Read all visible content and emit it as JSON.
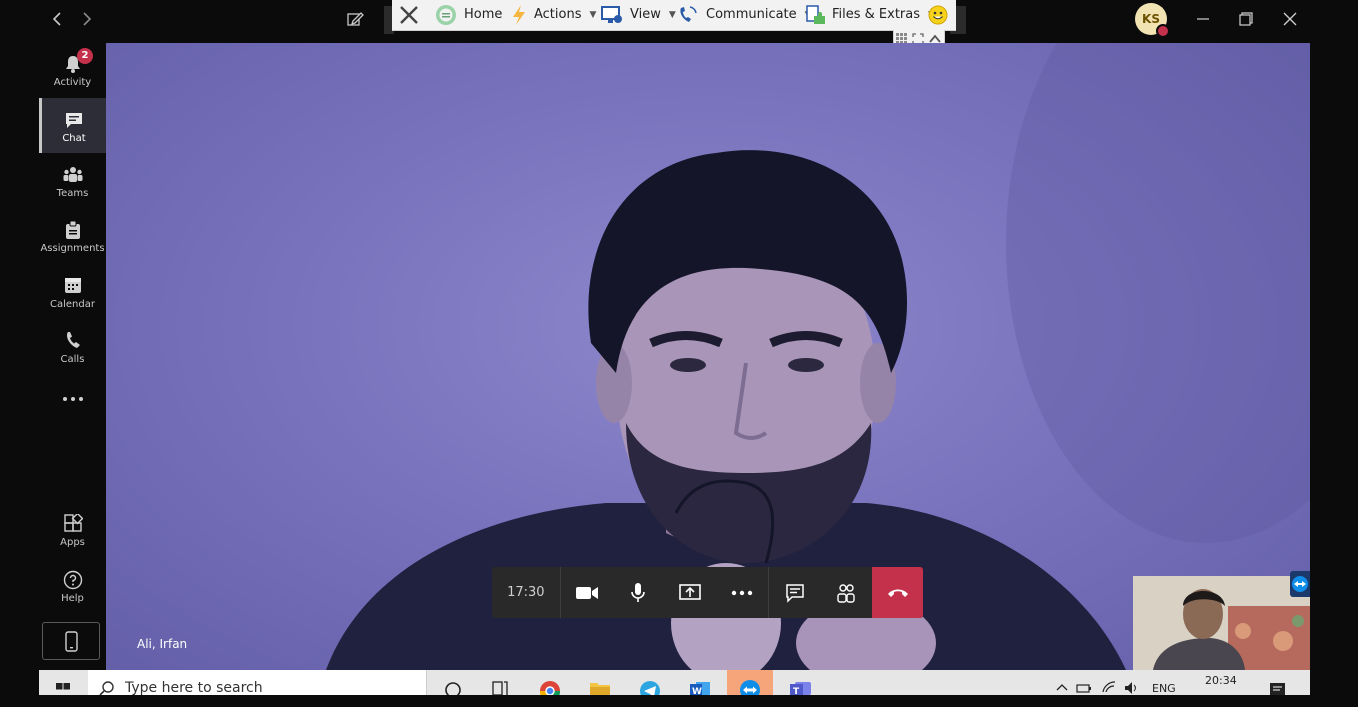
{
  "titlebar": {
    "back_icon": "chevron-left-icon",
    "forward_icon": "chevron-right-icon",
    "compose_icon": "compose-icon"
  },
  "teamviewer_bar": {
    "items": [
      {
        "label": "Home",
        "icon": "home-icon"
      },
      {
        "label": "Actions",
        "icon": "lightning-icon"
      },
      {
        "label": "View",
        "icon": "monitor-icon"
      },
      {
        "label": "Communicate",
        "icon": "phone-icon"
      },
      {
        "label": "Files & Extras",
        "icon": "puzzle-icon"
      }
    ]
  },
  "user": {
    "initials": "KS",
    "presence_color": "#c4314b"
  },
  "sidebar": {
    "items": [
      {
        "label": "Activity",
        "icon": "bell-icon",
        "badge": "2"
      },
      {
        "label": "Chat",
        "icon": "chat-icon"
      },
      {
        "label": "Teams",
        "icon": "teams-icon"
      },
      {
        "label": "Assignments",
        "icon": "assignments-icon"
      },
      {
        "label": "Calendar",
        "icon": "calendar-icon"
      },
      {
        "label": "Calls",
        "icon": "phone-icon"
      },
      {
        "label": "",
        "icon": "more-icon"
      },
      {
        "label": "Apps",
        "icon": "apps-icon"
      },
      {
        "label": "Help",
        "icon": "help-icon"
      }
    ],
    "active": "Chat"
  },
  "call": {
    "participant_name": "Ali, Irfan",
    "timer": "17:30",
    "hangup_color": "#c4314b"
  },
  "taskbar": {
    "search_placeholder": "Type here to search",
    "language": "ENG",
    "time": "20:34"
  }
}
